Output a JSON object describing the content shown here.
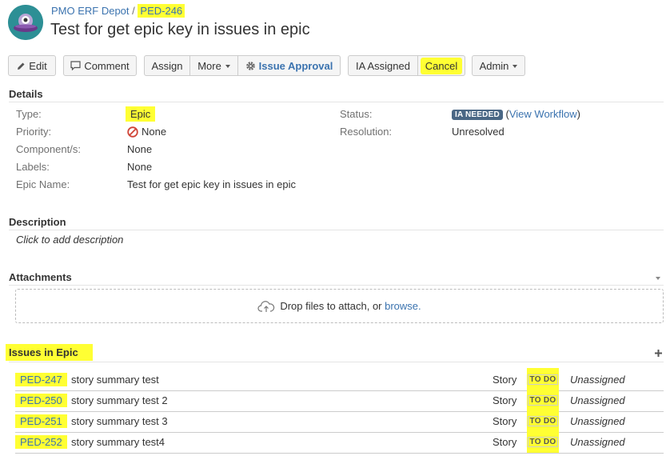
{
  "header": {
    "project": "PMO ERF Depot",
    "separator": "/",
    "issue_key": "PED-246",
    "title": "Test for get epic key in issues in epic"
  },
  "toolbar": {
    "edit": "Edit",
    "comment": "Comment",
    "assign": "Assign",
    "more": "More",
    "issue_approval": "Issue Approval",
    "ia_assigned": "IA Assigned",
    "cancel": "Cancel",
    "admin": "Admin"
  },
  "details": {
    "section_title": "Details",
    "type_label": "Type:",
    "type_value": "Epic",
    "priority_label": "Priority:",
    "priority_value": "None",
    "components_label": "Component/s:",
    "components_value": "None",
    "labels_label": "Labels:",
    "labels_value": "None",
    "epic_name_label": "Epic Name:",
    "epic_name_value": "Test for get epic key in issues in epic",
    "status_label": "Status:",
    "status_value": "IA NEEDED",
    "view_workflow_open": "(",
    "view_workflow": "View Workflow",
    "view_workflow_close": ")",
    "resolution_label": "Resolution:",
    "resolution_value": "Unresolved"
  },
  "description": {
    "section_title": "Description",
    "placeholder": "Click to add description"
  },
  "attachments": {
    "section_title": "Attachments",
    "drop_text": "Drop files to attach, or",
    "browse": "browse."
  },
  "issues_in_epic": {
    "section_title": "Issues in Epic",
    "rows": [
      {
        "key": "PED-247",
        "summary": "story summary test",
        "type": "Story",
        "status": "TO DO",
        "assignee": "Unassigned"
      },
      {
        "key": "PED-250",
        "summary": "story summary test 2",
        "type": "Story",
        "status": "TO DO",
        "assignee": "Unassigned"
      },
      {
        "key": "PED-251",
        "summary": "story summary test 3",
        "type": "Story",
        "status": "TO DO",
        "assignee": "Unassigned"
      },
      {
        "key": "PED-252",
        "summary": "story summary test4",
        "type": "Story",
        "status": "TO DO",
        "assignee": "Unassigned"
      }
    ]
  },
  "colors": {
    "highlight": "#ffff33",
    "link": "#3b73af",
    "status_lozenge": "#4a6785",
    "avatar": "#2d8f95"
  }
}
